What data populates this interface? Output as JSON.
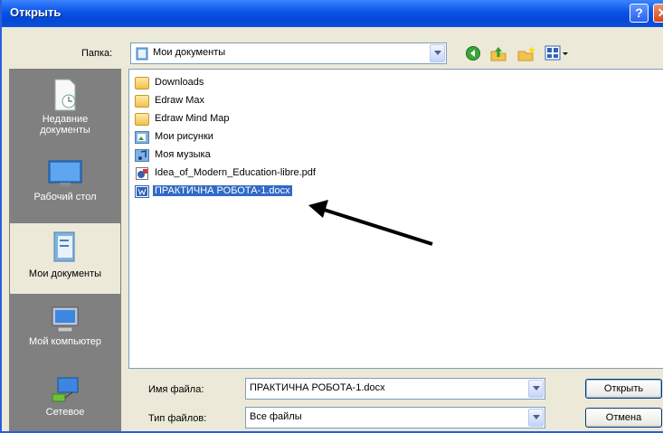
{
  "window": {
    "title": "Открыть",
    "help_label": "?"
  },
  "toolbar": {
    "folder_label": "Папка:",
    "folder_value": "Мои документы"
  },
  "places": [
    {
      "label": "Недавние документы",
      "icon": "recent-documents-icon"
    },
    {
      "label": "Рабочий стол",
      "icon": "desktop-icon"
    },
    {
      "label": "Мои документы",
      "icon": "my-documents-icon"
    },
    {
      "label": "Мой компьютер",
      "icon": "my-computer-icon"
    },
    {
      "label": "Сетевое",
      "icon": "network-icon"
    }
  ],
  "files": [
    {
      "name": "Downloads",
      "icon": "folder-icon"
    },
    {
      "name": "Edraw Max",
      "icon": "folder-icon"
    },
    {
      "name": "Edraw Mind Map",
      "icon": "folder-icon"
    },
    {
      "name": "Мои рисунки",
      "icon": "pictures-folder-icon"
    },
    {
      "name": "Моя музыка",
      "icon": "music-folder-icon"
    },
    {
      "name": "Idea_of_Modern_Education-libre.pdf",
      "icon": "pdf-file-icon"
    },
    {
      "name": "ПРАКТИЧНА РОБОТА-1.docx",
      "icon": "word-document-icon",
      "selected": true
    }
  ],
  "bottom": {
    "filename_label": "Имя файла:",
    "filename_value": "ПРАКТИЧНА РОБОТА-1.docx",
    "filetype_label": "Тип файлов:",
    "filetype_value": "Все файлы",
    "open_button": "Открыть",
    "cancel_button": "Отмена"
  },
  "colors": {
    "title_bar": "#0a53e8",
    "selection": "#316ac5",
    "places_bg": "#808080",
    "dialog_bg": "#ece9d8"
  }
}
